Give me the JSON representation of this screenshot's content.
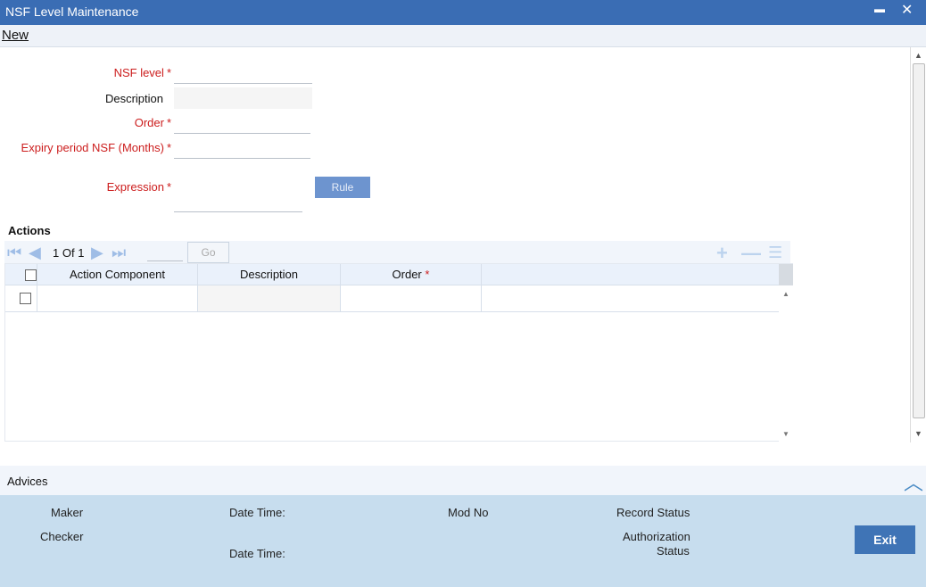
{
  "window": {
    "title": "NSF Level Maintenance",
    "minimize_glyph": "▬",
    "close_glyph": "✕"
  },
  "menu": {
    "new_label": "New"
  },
  "form": {
    "nsf_level_label": "NSF level",
    "description_label": "Description",
    "order_label": "Order",
    "expiry_label": "Expiry period NSF (Months)",
    "expression_label": "Expression",
    "required_mark": "*",
    "rule_button": "Rule"
  },
  "actions": {
    "heading": "Actions",
    "pager": {
      "current": "1",
      "of": "Of",
      "total": "1",
      "go_label": "Go"
    },
    "columns": [
      "Action Component",
      "Description",
      "Order"
    ],
    "required_mark": "*"
  },
  "advices": {
    "label": "Advices"
  },
  "footer": {
    "maker": "Maker",
    "checker": "Checker",
    "date_time_1": "Date Time:",
    "date_time_2": "Date Time:",
    "mod_no": "Mod No",
    "record_status": "Record Status",
    "authorization_status_1": "Authorization",
    "authorization_status_2": "Status",
    "exit_button": "Exit"
  }
}
